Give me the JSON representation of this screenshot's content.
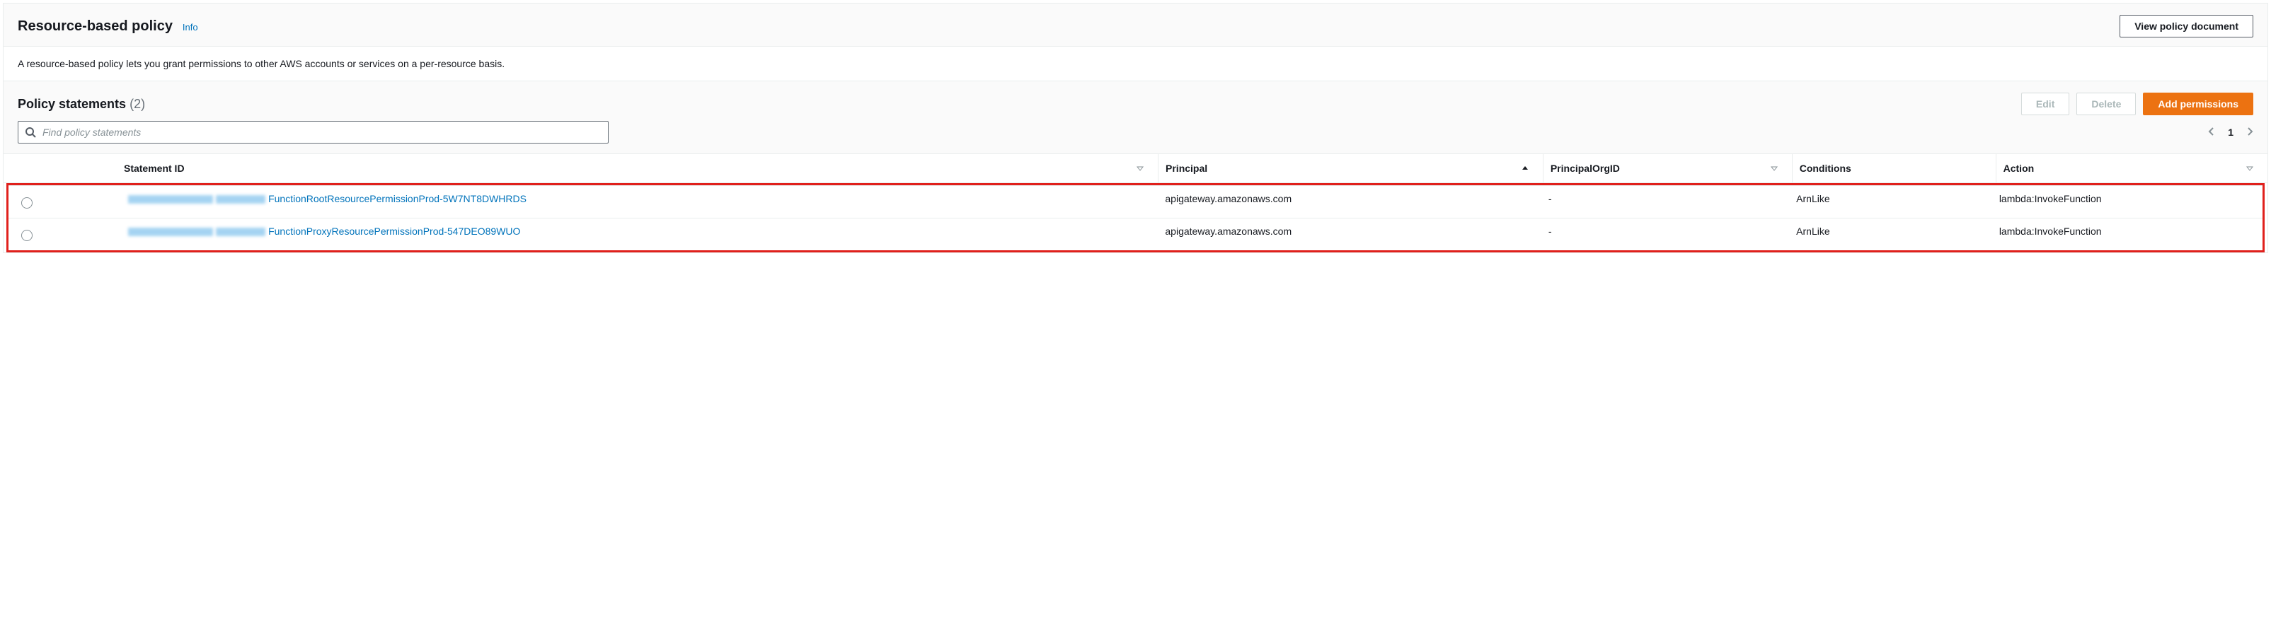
{
  "header": {
    "title": "Resource-based policy",
    "info": "Info",
    "view_doc": "View policy document"
  },
  "description": "A resource-based policy lets you grant permissions to other AWS accounts or services on a per-resource basis.",
  "statements": {
    "title": "Policy statements",
    "count": "(2)",
    "edit": "Edit",
    "delete": "Delete",
    "add": "Add permissions",
    "search_placeholder": "Find policy statements",
    "page": "1"
  },
  "columns": {
    "statement_id": "Statement ID",
    "principal": "Principal",
    "principal_org_id": "PrincipalOrgID",
    "conditions": "Conditions",
    "action": "Action"
  },
  "rows": [
    {
      "statement_id": "FunctionRootResourcePermissionProd-5W7NT8DWHRDS",
      "principal": "apigateway.amazonaws.com",
      "principal_org_id": "-",
      "conditions": "ArnLike",
      "action": "lambda:InvokeFunction"
    },
    {
      "statement_id": "FunctionProxyResourcePermissionProd-547DEO89WUO",
      "principal": "apigateway.amazonaws.com",
      "principal_org_id": "-",
      "conditions": "ArnLike",
      "action": "lambda:InvokeFunction"
    }
  ]
}
